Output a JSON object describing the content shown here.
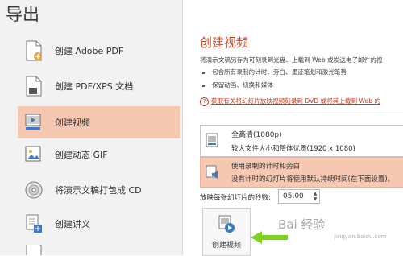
{
  "page": {
    "title": "导出"
  },
  "nav": {
    "items": [
      {
        "label": "创建 Adobe PDF",
        "icon": "pdf-doc-icon"
      },
      {
        "label": "创建 PDF/XPS 文档",
        "icon": "xps-doc-icon"
      },
      {
        "label": "创建视频",
        "icon": "video-icon",
        "active": true
      },
      {
        "label": "创建动态 GIF",
        "icon": "gif-icon"
      },
      {
        "label": "将演示文稿打包成 CD",
        "icon": "cd-icon"
      },
      {
        "label": "创建讲义",
        "icon": "handout-icon"
      }
    ]
  },
  "video": {
    "title": "创建视频",
    "description": "将演示文稿另存为可刻录到光盘、上载到 Web 或发送电子邮件的视",
    "bullets": [
      "包含所有录制的计时、旁白、墨迹笔划和激光笔势",
      "保留动画、切换和媒体"
    ],
    "help_link": "获取有关将幻灯片放映视频刻录到 DVD 或将其上载到 Web 的",
    "quality": {
      "title": "全高清(1080p)",
      "subtitle": "较大文件大小和整体优质(1920 x 1080)"
    },
    "recording": {
      "title": "使用录制的计时和旁白",
      "subtitle": "没有计时的幻灯片将使用默认持续时间(在下面设置)。"
    },
    "seconds_label": "放映每张幻灯片的秒数:",
    "seconds_value": "05.00",
    "create_button": "创建视频"
  },
  "watermark": {
    "text": "Bai 经验",
    "sub": "jingyan.baidu.com"
  },
  "colors": {
    "accent": "#d24726",
    "active_bg": "#f6c8b2",
    "arrow": "#7ed321"
  }
}
